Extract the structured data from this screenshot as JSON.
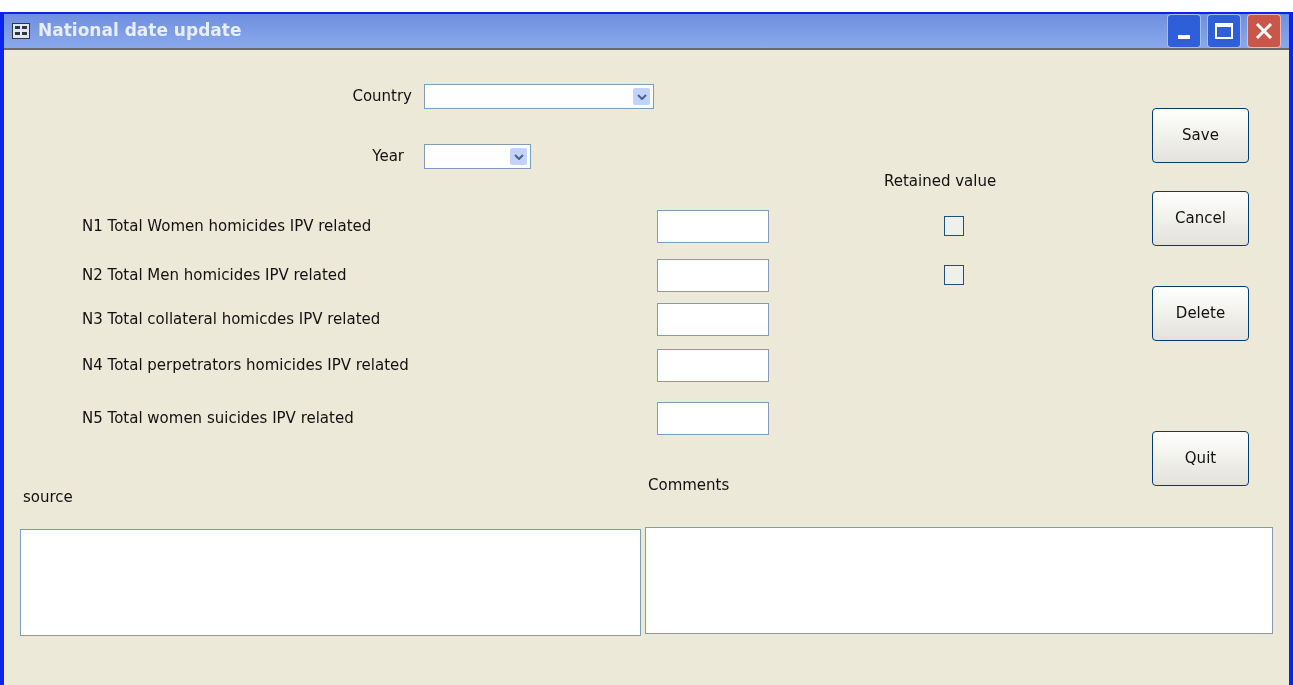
{
  "window": {
    "title": "National date update"
  },
  "country": {
    "label": "Country"
  },
  "year": {
    "label": "Year"
  },
  "retained_header": "Retained value",
  "fields": [
    {
      "label": "N1 Total Women homicides IPV related",
      "retained_checked": false
    },
    {
      "label": "N2 Total Men homicides IPV related",
      "retained_checked": false
    },
    {
      "label": "N3 Total collateral homicdes IPV related"
    },
    {
      "label": "N4 Total perpetrators homicides IPV related"
    },
    {
      "label": "N5 Total women suicides IPV related"
    }
  ],
  "buttons": [
    {
      "label": "Save"
    },
    {
      "label": "Cancel"
    },
    {
      "label": "Delete"
    },
    {
      "label": "Quit"
    }
  ],
  "source": {
    "label": "source"
  },
  "comments": {
    "label": "Comments"
  }
}
